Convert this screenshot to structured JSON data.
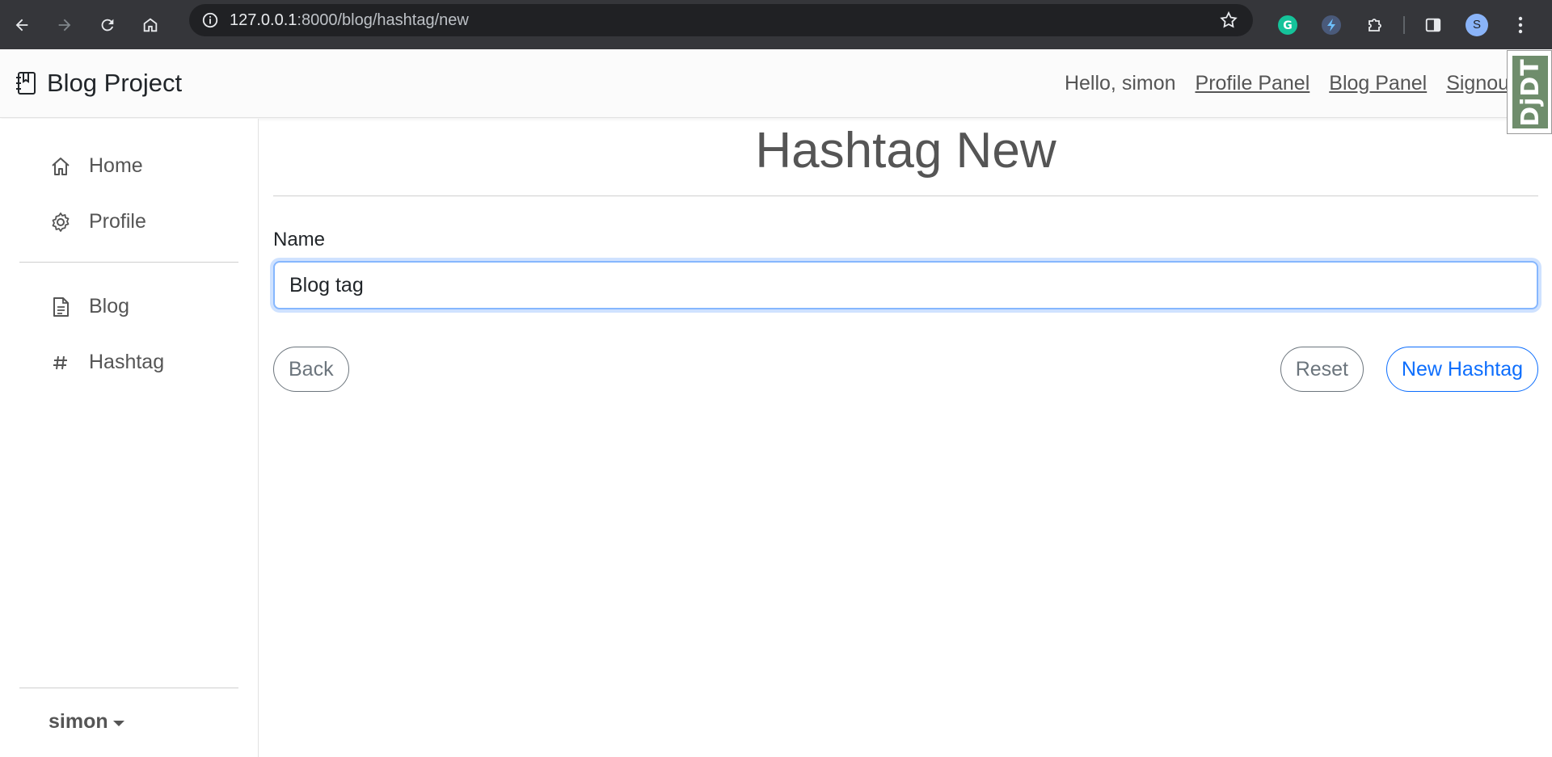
{
  "browser": {
    "url_host": "127.0.0.1",
    "url_path": ":8000/blog/hashtag/new",
    "profile_initial": "S"
  },
  "navbar": {
    "brand": "Blog Project",
    "greeting": "Hello, simon",
    "links": [
      "Profile Panel",
      "Blog Panel",
      "Signout"
    ],
    "debug_toolbar": "DjDT"
  },
  "sidebar": {
    "items": [
      {
        "label": "Home",
        "icon": "home-icon"
      },
      {
        "label": "Profile",
        "icon": "gear-icon"
      },
      {
        "label": "Blog",
        "icon": "document-icon"
      },
      {
        "label": "Hashtag",
        "icon": "hash-icon"
      }
    ],
    "user": "simon"
  },
  "main": {
    "title": "Hashtag New",
    "field_label": "Name",
    "field_value": "Blog tag",
    "buttons": {
      "back": "Back",
      "reset": "Reset",
      "submit": "New Hashtag"
    }
  },
  "colors": {
    "primary": "#0d6efd",
    "secondary": "#6c757d",
    "chrome": "#35363a",
    "debug_toolbar": "#6f8d6c"
  }
}
